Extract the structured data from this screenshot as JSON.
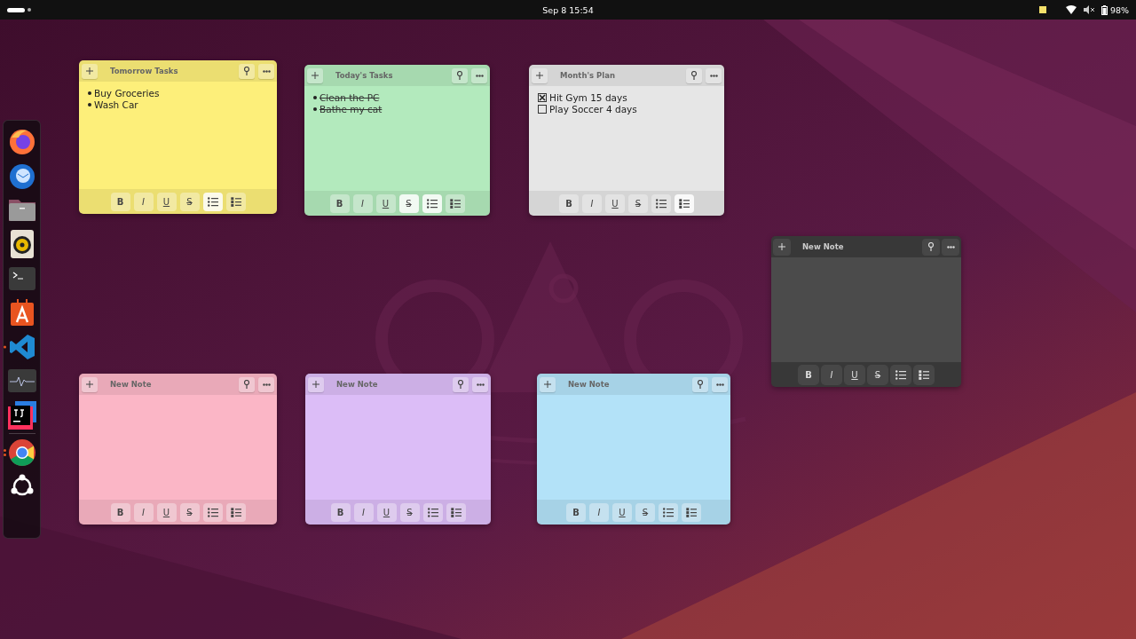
{
  "top_bar": {
    "clock": "Sep 8  15:54",
    "battery": "98%"
  },
  "dock": [
    {
      "kind": "firefox",
      "running": false,
      "multiple_windows": false
    },
    {
      "kind": "thunderbird",
      "running": false,
      "multiple_windows": false
    },
    {
      "kind": "files",
      "running": false,
      "multiple_windows": false
    },
    {
      "kind": "rhythmbox",
      "running": false,
      "multiple_windows": false
    },
    {
      "kind": "terminal",
      "running": false,
      "multiple_windows": false
    },
    {
      "kind": "appcenter",
      "running": false,
      "multiple_windows": false
    },
    {
      "kind": "vscode",
      "running": true,
      "multiple_windows": false
    },
    {
      "kind": "monitor",
      "running": false,
      "multiple_windows": false
    },
    {
      "kind": "intellij",
      "running": false,
      "multiple_windows": false
    },
    {
      "kind": "separator"
    },
    {
      "kind": "chrome",
      "running": true,
      "multiple_windows": true
    },
    {
      "kind": "ubuntu",
      "running": false,
      "multiple_windows": false
    }
  ],
  "notes": [
    {
      "title": "Tomorrow Tasks",
      "color": "#fdef7a",
      "dark": false,
      "items": [
        {
          "kind": "bullet",
          "text": "Buy Groceries",
          "struck": false
        },
        {
          "kind": "bullet",
          "text": "Wash Car",
          "struck": false
        }
      ],
      "toolbar": [
        {
          "kind": "bold",
          "label": "B",
          "selected": false
        },
        {
          "kind": "italic",
          "label": "I",
          "selected": false
        },
        {
          "kind": "underline",
          "label": "U",
          "selected": false
        },
        {
          "kind": "strike",
          "label": "S",
          "selected": false
        },
        {
          "kind": "bullets",
          "selected": true
        },
        {
          "kind": "checklist",
          "selected": false
        }
      ]
    },
    {
      "title": "Today's Tasks",
      "color": "#b3eabd",
      "dark": false,
      "items": [
        {
          "kind": "bullet",
          "text": "Clean the PC",
          "struck": true
        },
        {
          "kind": "bullet",
          "text": "Bathe my cat",
          "struck": true
        }
      ],
      "toolbar": [
        {
          "kind": "bold",
          "label": "B",
          "selected": false
        },
        {
          "kind": "italic",
          "label": "I",
          "selected": false
        },
        {
          "kind": "underline",
          "label": "U",
          "selected": false
        },
        {
          "kind": "strike",
          "label": "S",
          "selected": true
        },
        {
          "kind": "bullets",
          "selected": true
        },
        {
          "kind": "checklist",
          "selected": false
        }
      ]
    },
    {
      "title": "Month's Plan",
      "color": "#e6e6e6",
      "dark": false,
      "items": [
        {
          "kind": "check",
          "text": "Hit Gym 15 days",
          "checked": true
        },
        {
          "kind": "check",
          "text": "Play Soccer 4 days",
          "checked": false
        }
      ],
      "toolbar": [
        {
          "kind": "bold",
          "label": "B",
          "selected": false
        },
        {
          "kind": "italic",
          "label": "I",
          "selected": false
        },
        {
          "kind": "underline",
          "label": "U",
          "selected": false
        },
        {
          "kind": "strike",
          "label": "S",
          "selected": false
        },
        {
          "kind": "bullets",
          "selected": false
        },
        {
          "kind": "checklist",
          "selected": true
        }
      ]
    },
    {
      "title": "New Note",
      "color": "#4b4b4b",
      "dark": true,
      "toolbar": [
        {
          "kind": "bold",
          "label": "B",
          "selected": false
        },
        {
          "kind": "italic",
          "label": "I",
          "selected": false
        },
        {
          "kind": "underline",
          "label": "U",
          "selected": false
        },
        {
          "kind": "strike",
          "label": "S",
          "selected": false
        },
        {
          "kind": "bullets",
          "selected": false
        },
        {
          "kind": "checklist",
          "selected": false
        }
      ]
    },
    {
      "title": "New Note",
      "color": "#fbb6c6",
      "dark": false,
      "toolbar": [
        {
          "kind": "bold",
          "label": "B",
          "selected": false
        },
        {
          "kind": "italic",
          "label": "I",
          "selected": false
        },
        {
          "kind": "underline",
          "label": "U",
          "selected": false
        },
        {
          "kind": "strike",
          "label": "S",
          "selected": false
        },
        {
          "kind": "bullets",
          "selected": false
        },
        {
          "kind": "checklist",
          "selected": false
        }
      ]
    },
    {
      "title": "New Note",
      "color": "#dcbdf7",
      "dark": false,
      "toolbar": [
        {
          "kind": "bold",
          "label": "B",
          "selected": false
        },
        {
          "kind": "italic",
          "label": "I",
          "selected": false
        },
        {
          "kind": "underline",
          "label": "U",
          "selected": false
        },
        {
          "kind": "strike",
          "label": "S",
          "selected": false
        },
        {
          "kind": "bullets",
          "selected": false
        },
        {
          "kind": "checklist",
          "selected": false
        }
      ]
    },
    {
      "title": "New Note",
      "color": "#b3e2f8",
      "dark": false,
      "toolbar": [
        {
          "kind": "bold",
          "label": "B",
          "selected": false
        },
        {
          "kind": "italic",
          "label": "I",
          "selected": false
        },
        {
          "kind": "underline",
          "label": "U",
          "selected": false
        },
        {
          "kind": "strike",
          "label": "S",
          "selected": false
        },
        {
          "kind": "bullets",
          "selected": false
        },
        {
          "kind": "checklist",
          "selected": false
        }
      ]
    }
  ]
}
